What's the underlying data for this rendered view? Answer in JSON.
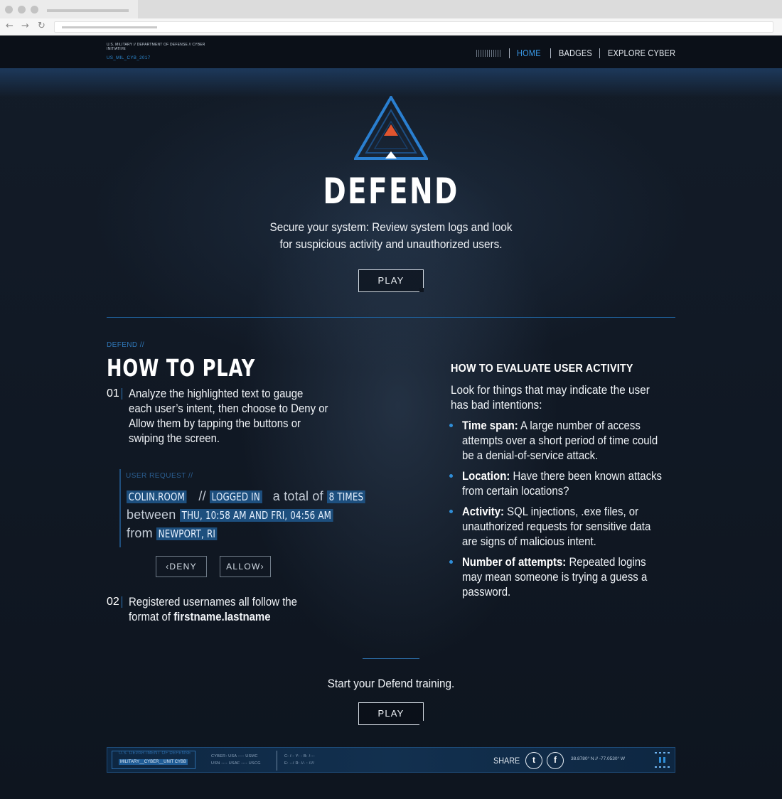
{
  "header": {
    "logo_line1": "U.S. MILITARY // DEPARTMENT OF DEFENSE // CYBER INITIATIVE",
    "logo_line2": "US_MIL_CYB_2017",
    "nav": [
      {
        "label": "HOME"
      },
      {
        "label": "BADGES"
      },
      {
        "label": "EXPLORE CYBER"
      }
    ]
  },
  "hero": {
    "title": "DEFEND",
    "description": "Secure your system: Review system logs and look for suspicious activity and unauthorized users.",
    "play_label": "PLAY"
  },
  "how_to_play": {
    "kicker": "DEFEND //",
    "title": "HOW TO PLAY",
    "steps": [
      {
        "num": "01",
        "text": "Analyze the highlighted text to gauge each user’s intent, then choose to Deny or Allow them by tapping the buttons or swiping the screen."
      },
      {
        "num": "02",
        "text_plain": "Registered usernames all follow the format of ",
        "text_bold": "firstname.lastname"
      }
    ],
    "example": {
      "label": "USER REQUEST //",
      "user": "COLIN.ROOM",
      "sep": "//",
      "action": "LOGGED IN",
      "total_prefix": "a total of",
      "count": "8 TIMES",
      "between": "between",
      "timespan": "THU, 10:58 AM AND FRI, 04:56 AM",
      "from": "from",
      "location": "NEWPORT, RI",
      "deny_label": "DENY",
      "allow_label": "ALLOW"
    }
  },
  "evaluate": {
    "title": "HOW TO EVALUATE USER ACTIVITY",
    "intro": "Look for things that may indicate the user has bad intentions:",
    "items": [
      {
        "term": "Time span:",
        "text": " A large number of access attempts over a short period of time could be a denial-of-service attack."
      },
      {
        "term": "Location:",
        "text": " Have there been known attacks from certain locations?"
      },
      {
        "term": "Activity:",
        "text": " SQL injections, .exe files, or unauthorized requests for sensitive data are signs of malicious intent."
      },
      {
        "term": "Number of attempts:",
        "text": " Repeated logins may mean someone is trying a guess a password."
      }
    ]
  },
  "cta": {
    "text": "Start your Defend training.",
    "play_label": "PLAY"
  },
  "footer": {
    "dept": "U.S. DEPARTMENT OF DEFENSE",
    "unit": "MILITARY__CYBER__UNIT CYBB",
    "branches1": "CYBER: USA ---- USMC",
    "branches2": "USN ---- USAF ---- USCG",
    "codes1": "C: /--   Y: -     B: /---",
    "codes2": "E: --/   R: //-   : ////",
    "share_label": "SHARE",
    "twitter": "twitter-icon",
    "facebook": "facebook-icon",
    "coords": "38.8780° N // -77.0530° W"
  },
  "colors": {
    "accent": "#2f8ed8",
    "highlight_bg": "#1d4f7e",
    "background": "#0d131c"
  }
}
